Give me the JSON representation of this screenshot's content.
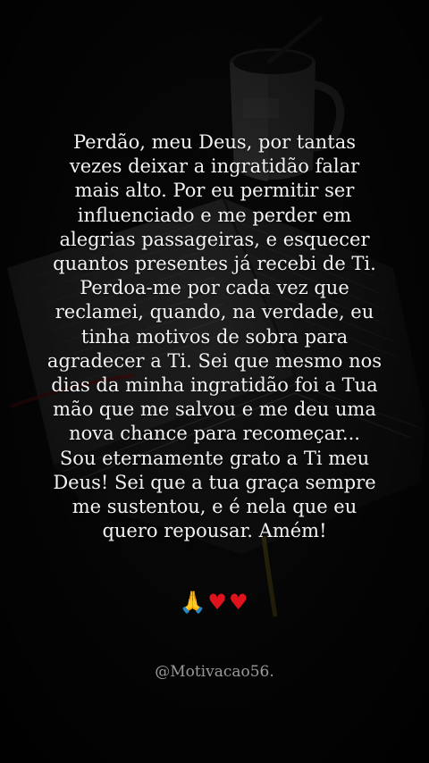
{
  "post": {
    "prayer_text": "Perdão, meu Deus, por tantas\nvezes deixar a ingratidão falar\nmais alto. Por eu permitir ser\ninfluenciado e me perder em\nalegrias passageiras, e esquecer\nquantos presentes já recebi de Ti.\nPerdoa-me por cada vez que\nreclamei, quando, na verdade, eu\ntinha motivos de sobra para\nagradecer a Ti. Sei que mesmo nos\ndias da minha ingratidão foi a Tua\nmão que me salvou e me deu uma\nnova chance para recomeçar...\nSou eternamente grato a Ti meu\nDeus! Sei que a tua graça sempre\nme sustentou, e é nela que eu\nquero repousar. Amém!",
    "emoji_praying": "🙏",
    "emoji_heart_1": "♥",
    "emoji_heart_2": "♥",
    "handle": "@Motivacao56."
  },
  "colors": {
    "background": "#0a0a0a",
    "text": "#f2f2f2",
    "handle": "#9a9a9a",
    "heart": "#e0121b"
  },
  "icons": {
    "praying": "praying-hands-icon",
    "heart": "red-heart-icon"
  }
}
